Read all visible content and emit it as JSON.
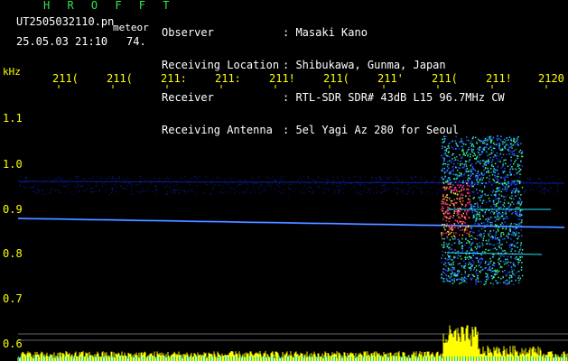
{
  "header": {
    "program": "H R O F F T",
    "filename": "UT2505032110.pn",
    "tag": "meteor",
    "timestamp": "25.05.03 21:10",
    "count": "74.",
    "fields": [
      {
        "label": "Observer",
        "value": ": Masaki Kano"
      },
      {
        "label": "Receiving Location",
        "value": ": Shibukawa, Gunma, Japan"
      },
      {
        "label": "Receiver",
        "value": ": RTL-SDR SDR# 43dB L15 96.7MHz CW"
      },
      {
        "label": "Receiving Antenna",
        "value": ": 5el Yagi Az 280 for Seoul"
      }
    ]
  },
  "plot": {
    "y_unit": "kHz",
    "x_ticks": [
      "211(",
      "211(",
      "211:",
      "211:",
      "211!",
      "211(",
      "211'",
      "211(",
      "211!",
      "2120"
    ],
    "y_ticks": [
      "1.1",
      "1.0",
      "0.9",
      "0.8",
      "0.7",
      "0.6"
    ],
    "colors": {
      "axis": "#ffff00",
      "title": "#2ee84a",
      "text": "#ffffff"
    }
  }
}
